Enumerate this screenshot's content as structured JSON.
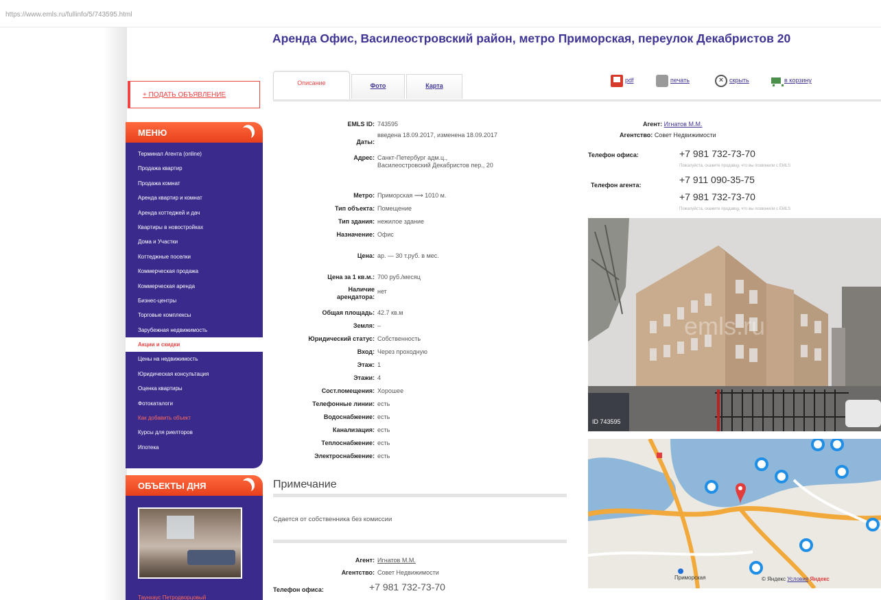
{
  "url": "https://www.emls.ru/fullinfo/5/743595.html",
  "sidebar": {
    "post_ad": "+ ПОДАТЬ ОБЪЯВЛЕНИЕ",
    "menu_title": "МЕНЮ",
    "menu_items": [
      "Терминал Агента (online)",
      "Продажа квартир",
      "Продажа комнат",
      "Аренда квартир и комнат",
      "Аренда коттеджей и дач",
      "Квартиры в новостройках",
      "Дома и Участки",
      "Коттеджные поселки",
      "Коммерческая продажа",
      "Коммерческая аренда",
      "Бизнес-центры",
      "Торговые комплексы",
      "Зарубежная недвижимость",
      "Акции и скидки",
      "Цены на недвижимость",
      "Юридическая консультация",
      "Оценка квартиры",
      "Фотокаталоги",
      "Как добавить объект",
      "Курсы для риелторов",
      "Ипотека"
    ],
    "objects_title": "ОБЪЕКТЫ ДНЯ",
    "objects_link": "Таунхаус Петродворцовый"
  },
  "page": {
    "title": "Аренда Офис, Василеостровский район, метро Приморская, переулок Декабристов 20",
    "tabs": [
      "Описание",
      "Фото",
      "Карта"
    ],
    "actions": {
      "pdf": "pdf",
      "print": "печать",
      "hide": "скрыть",
      "cart": "в корзину"
    }
  },
  "details": [
    {
      "k": "EMLS ID:",
      "v": "743595"
    },
    {
      "k": "Даты:",
      "v": "введена 18.09.2017, изменена 18.09.2017"
    },
    {
      "k": "Адрес:",
      "v": "Санкт-Петербург адм.ц., Василеостровский Декабристов пер., 20"
    },
    {
      "k": "Метро:",
      "v": "Приморская ⟶ 1010 м."
    },
    {
      "k": "Тип объекта:",
      "v": "Помещение"
    },
    {
      "k": "Тип здания:",
      "v": "нежилое здание"
    },
    {
      "k": "Назначение:",
      "v": "Офис"
    },
    {
      "k": "Цена:",
      "v": "ар. — 30 т.руб. в мес."
    },
    {
      "k": "Цена за 1 кв.м.:",
      "v": "700 руб./месяц"
    },
    {
      "k": "Наличие арендатора:",
      "v": "нет"
    },
    {
      "k": "Общая площадь:",
      "v": "42.7 кв.м"
    },
    {
      "k": "Земля:",
      "v": "–"
    },
    {
      "k": "Юридический статус:",
      "v": "Собственность"
    },
    {
      "k": "Вход:",
      "v": "Через проходную"
    },
    {
      "k": "Этаж:",
      "v": "1"
    },
    {
      "k": "Этажи:",
      "v": "4"
    },
    {
      "k": "Сост.помещения:",
      "v": "Хорошее"
    },
    {
      "k": "Телефонные линии:",
      "v": "есть"
    },
    {
      "k": "Водоснабжение:",
      "v": "есть"
    },
    {
      "k": "Канализация:",
      "v": "есть"
    },
    {
      "k": "Теплоснабжение:",
      "v": "есть"
    },
    {
      "k": "Электроснабжение:",
      "v": "есть"
    }
  ],
  "note": {
    "heading": "Примечание",
    "text": "Сдается от собственника без комиссии"
  },
  "agent": {
    "agent_label": "Агент:",
    "agent_name": "Игнатов М.М.",
    "agency_label": "Агентство:",
    "agency_name": "Совет Недвижимости",
    "office_phone_label": "Телефон офиса:",
    "office_phone": "+7 981 732-73-70",
    "agent_phone_label": "Телефон агента:",
    "agent_phone_1": "+7 911 090-35-75",
    "agent_phone_2": "+7 981 732-73-70",
    "phone_note": "Пожалуйста, скажите продавцу, что вы позвонили с EMLS"
  },
  "photo": {
    "id_label": "ID 743595",
    "watermark": "emls.ru"
  },
  "map": {
    "station": "Приморская",
    "copyright": "© Яндекс",
    "terms": "Условия",
    "brand": "Яндекс"
  }
}
